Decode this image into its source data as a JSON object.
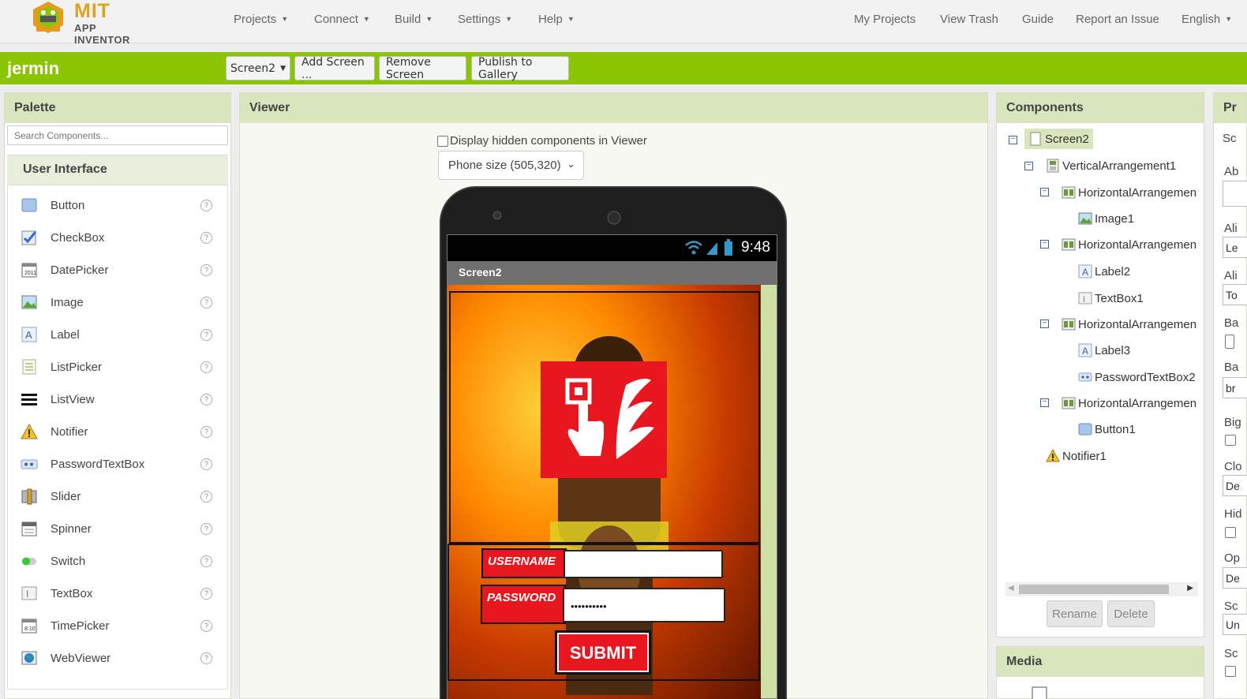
{
  "brand": {
    "mit": "MIT",
    "app": "APP INVENTOR"
  },
  "topnav": {
    "left": [
      "Projects",
      "Connect",
      "Build",
      "Settings",
      "Help"
    ],
    "right": [
      "My Projects",
      "View Trash",
      "Guide",
      "Report an Issue",
      "English"
    ]
  },
  "project": {
    "name": "jermin",
    "screen_select": "Screen2",
    "add_screen": "Add Screen ...",
    "remove_screen": "Remove Screen",
    "publish": "Publish to Gallery"
  },
  "palette": {
    "title": "Palette",
    "search_placeholder": "Search Components...",
    "category": "User Interface",
    "items": [
      "Button",
      "CheckBox",
      "DatePicker",
      "Image",
      "Label",
      "ListPicker",
      "ListView",
      "Notifier",
      "PasswordTextBox",
      "Slider",
      "Spinner",
      "Switch",
      "TextBox",
      "TimePicker",
      "WebViewer"
    ],
    "help_glyph": "?"
  },
  "viewer": {
    "title": "Viewer",
    "hidden_label": "Display hidden components in Viewer",
    "phone_size": "Phone size (505,320)",
    "status_time": "9:48",
    "screen_title": "Screen2",
    "username_label": "USERNAME",
    "password_label": "PASSWORD",
    "password_value": "••••••••••",
    "submit_label": "SUBMIT"
  },
  "components": {
    "title": "Components",
    "tree": [
      "Screen2",
      "VerticalArrangement1",
      "HorizontalArrangemen",
      "Image1",
      "HorizontalArrangemen",
      "Label2",
      "TextBox1",
      "HorizontalArrangemen",
      "Label3",
      "PasswordTextBox2",
      "HorizontalArrangemen",
      "Button1",
      "Notifier1"
    ],
    "rename": "Rename",
    "delete": "Delete",
    "media_title": "Media"
  },
  "properties": {
    "title": "Pr",
    "screen": "Sc",
    "labels": [
      "Ab",
      "Ali",
      "Ali",
      "Ba",
      "Ba",
      "Big",
      "Clo",
      "Hid",
      "Op",
      "Sc",
      "Sc"
    ],
    "values": [
      "Le",
      "To",
      "br",
      "De",
      "De",
      "Un"
    ]
  },
  "colors": {
    "green_bar": "#8bc400",
    "panel_header": "#d8e5bd",
    "alarm_red": "#e8161f"
  }
}
